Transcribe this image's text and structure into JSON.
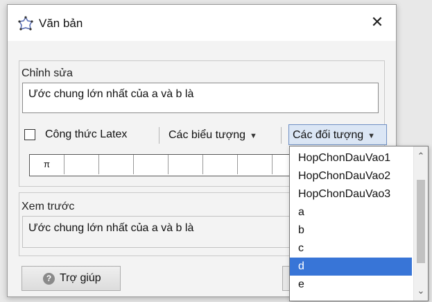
{
  "window": {
    "title": "Văn bản",
    "icon": "polygon-star-icon",
    "close_label": "✕"
  },
  "edit": {
    "label": "Chỉnh sửa",
    "text": "Ước chung lớn nhất của a và b là",
    "latex_label": "Công thức Latex",
    "latex_checked": false,
    "symbols_label": "Các biểu tượng",
    "objects_label": "Các đối tượng",
    "symbol_cells": [
      "π",
      "",
      "",
      "",
      "",
      "",
      "",
      ""
    ]
  },
  "preview": {
    "label": "Xem trước",
    "text": "Ước chung lớn nhất của a và b là"
  },
  "buttons": {
    "help_label": "Trợ giúp"
  },
  "dropdown": {
    "items": [
      "HopChonDauVao1",
      "HopChonDauVao2",
      "HopChonDauVao3",
      "a",
      "b",
      "c",
      "d",
      "e"
    ],
    "selected_index": 6,
    "selected_value": "d"
  },
  "colors": {
    "selection": "#3875d7",
    "accent_button": "#dbe6f5"
  }
}
